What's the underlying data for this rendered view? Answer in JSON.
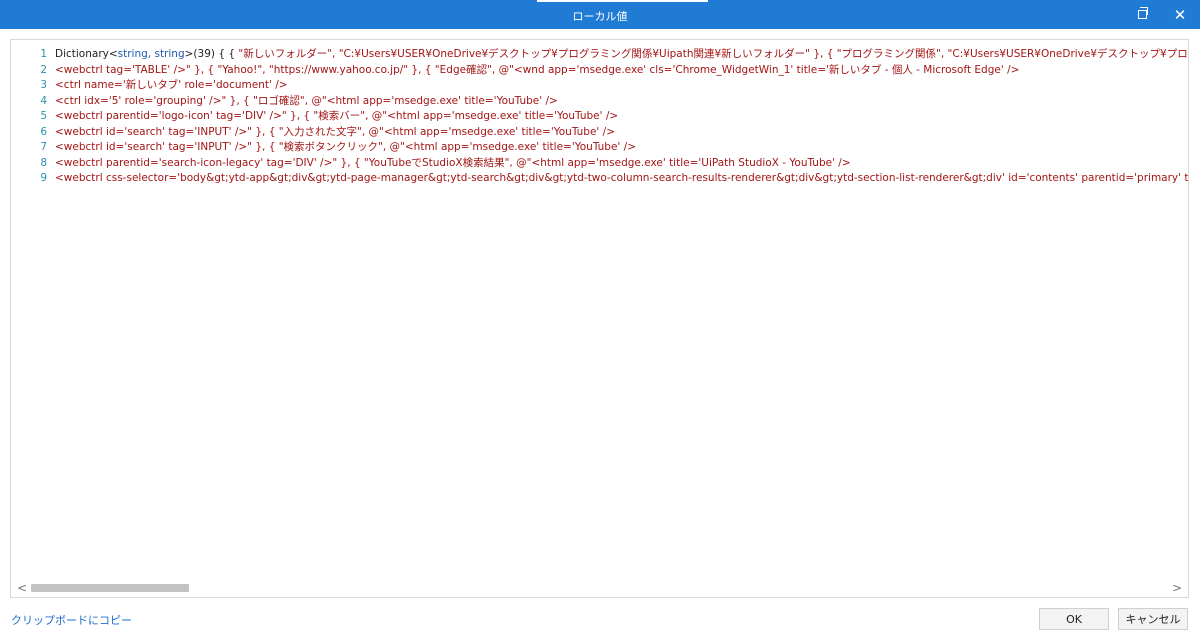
{
  "window": {
    "title": "ローカル値",
    "restore_glyph": "restore-icon",
    "close_glyph": "✕"
  },
  "editor": {
    "lines": [
      {
        "num": "1",
        "parts": [
          {
            "t": "Dictionary<",
            "c": "plain"
          },
          {
            "t": "string, string",
            "c": "kw"
          },
          {
            "t": ">(39) { { ",
            "c": "plain"
          },
          {
            "t": "\"新しいフォルダー\", \"C:¥Users¥USER¥OneDrive¥デスクトップ¥プログラミング関係¥Uipath関連¥新しいフォルダー\" }, { \"プログラミング関係\", \"C:¥Users¥USER¥OneDrive¥デスクトップ¥プログラミング関係\" }, { \"VBA開発_note公開用\", \"C:¥",
            "c": "str"
          }
        ]
      },
      {
        "num": "2",
        "parts": [
          {
            "t": "<webctrl tag='TABLE' />\" }, { \"Yahoo!\", \"https://www.yahoo.co.jp/\" }, { \"Edge確認\", @\"<wnd app='msedge.exe' cls='Chrome_WidgetWin_1' title='新しいタブ - 個人 - Microsoft Edge' />",
            "c": "str"
          }
        ]
      },
      {
        "num": "3",
        "parts": [
          {
            "t": "<ctrl name='新しいタブ' role='document' />",
            "c": "str"
          }
        ]
      },
      {
        "num": "4",
        "parts": [
          {
            "t": "<ctrl idx='5' role='grouping' />\" }, { \"ロゴ確認\", @\"<html app='msedge.exe' title='YouTube' />",
            "c": "str"
          }
        ]
      },
      {
        "num": "5",
        "parts": [
          {
            "t": "<webctrl parentid='logo-icon' tag='DIV' />\" }, { \"検索バー\", @\"<html app='msedge.exe' title='YouTube' />",
            "c": "str"
          }
        ]
      },
      {
        "num": "6",
        "parts": [
          {
            "t": "<webctrl id='search' tag='INPUT' />\" }, { \"入力された文字\", @\"<html app='msedge.exe' title='YouTube' />",
            "c": "str"
          }
        ]
      },
      {
        "num": "7",
        "parts": [
          {
            "t": "<webctrl id='search' tag='INPUT' />\" }, { \"検索ボタンクリック\", @\"<html app='msedge.exe' title='YouTube' />",
            "c": "str"
          }
        ]
      },
      {
        "num": "8",
        "parts": [
          {
            "t": "<webctrl parentid='search-icon-legacy' tag='DIV' />\" }, { \"YouTubeでStudioX検索結果\", @\"<html app='msedge.exe' title='UiPath StudioX - YouTube' />",
            "c": "str"
          }
        ]
      },
      {
        "num": "9",
        "parts": [
          {
            "t": "<webctrl css-selector='body&gt;ytd-app&gt;div&gt;ytd-page-manager&gt;ytd-search&gt;div&gt;ytd-two-column-search-results-renderer&gt;div&gt;ytd-section-list-renderer&gt;div' id='contents' parentid='primary' tag='DIV' />\" }, { \"次の経過",
            "c": "str"
          }
        ]
      }
    ],
    "scroll_left_glyph": "<",
    "scroll_right_glyph": ">"
  },
  "footer": {
    "copy_label": "クリップボードにコピー",
    "ok_label": "OK",
    "cancel_label": "キャンセル"
  },
  "colors": {
    "titlebar": "#1f7bd4",
    "line_number": "#2b91af",
    "string": "#a31515",
    "keyword": "#1f5ab0",
    "link": "#1f6ccf"
  }
}
